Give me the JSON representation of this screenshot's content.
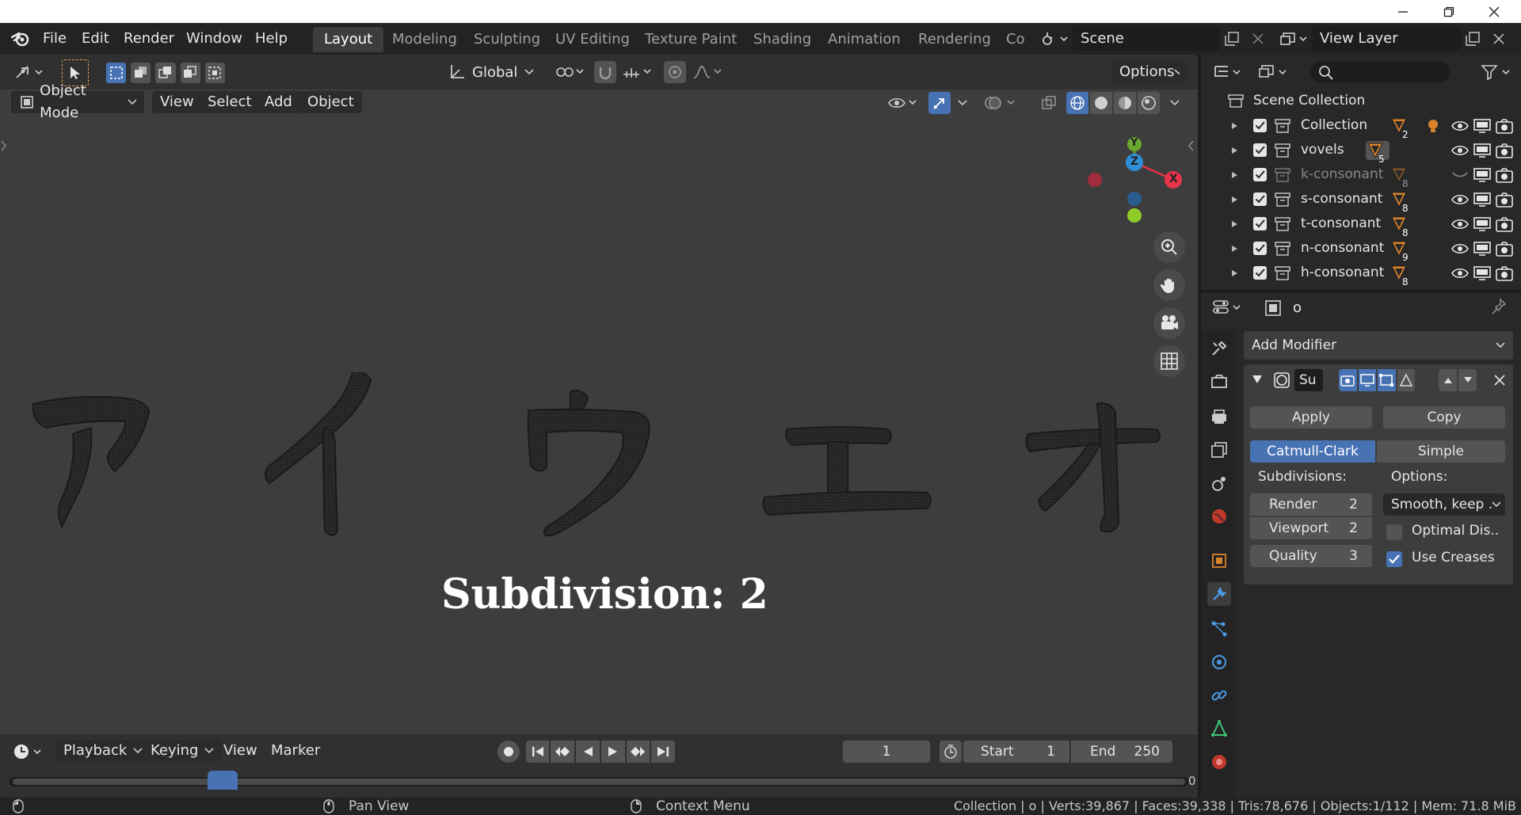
{
  "menu": {
    "items": [
      "File",
      "Edit",
      "Render",
      "Window",
      "Help"
    ]
  },
  "workspaces": [
    "Layout",
    "Modeling",
    "Sculpting",
    "UV Editing",
    "Texture Paint",
    "Shading",
    "Animation",
    "Rendering",
    "Co"
  ],
  "scene": {
    "name": "Scene",
    "view_layer": "View Layer"
  },
  "viewport": {
    "orientation": "Global",
    "options_label": "Options",
    "mode": "Object Mode",
    "menus": [
      "View",
      "Select",
      "Add",
      "Object"
    ],
    "overlay_text": "Subdivision: 2",
    "katakana": [
      "ア",
      "イ",
      "ウ",
      "エ",
      "オ"
    ],
    "gizmo_axes": {
      "x": "X",
      "y": "Y",
      "z": "Z"
    }
  },
  "outliner": {
    "root": "Scene Collection",
    "collections": [
      {
        "name": "Collection",
        "count": "2",
        "dim": false
      },
      {
        "name": "vovels",
        "count": "5",
        "dim": false
      },
      {
        "name": "k-consonant",
        "count": "8",
        "dim": true
      },
      {
        "name": "s-consonant",
        "count": "8",
        "dim": false
      },
      {
        "name": "t-consonant",
        "count": "8",
        "dim": false
      },
      {
        "name": "n-consonant",
        "count": "9",
        "dim": false
      },
      {
        "name": "h-consonant",
        "count": "8",
        "dim": false
      }
    ]
  },
  "properties": {
    "object_name": "o",
    "add_modifier": "Add Modifier",
    "modifier_name": "Su",
    "apply": "Apply",
    "copy": "Copy",
    "catmull": "Catmull-Clark",
    "simple": "Simple",
    "subdivisions_label": "Subdivisions:",
    "options_label": "Options:",
    "render_label": "Render",
    "render_value": "2",
    "viewport_label": "Viewport",
    "viewport_value": "2",
    "quality_label": "Quality",
    "quality_value": "3",
    "uv_smooth": "Smooth, keep ...",
    "optimal_display": "Optimal Dis..",
    "use_creases": "Use Creases"
  },
  "timeline": {
    "playback": "Playback",
    "keying": "Keying",
    "view": "View",
    "marker": "Marker",
    "current_frame": "1",
    "start_label": "Start",
    "start_value": "1",
    "end_label": "End",
    "end_value": "250",
    "scrub_end": "0"
  },
  "status": {
    "pan_view": "Pan View",
    "context_menu": "Context Menu",
    "stats": "Collection | o | Verts:39,867 | Faces:39,338 | Tris:78,676 | Objects:1/112 | Mem: 71.8 MiB"
  },
  "colors": {
    "accent": "#4772b3",
    "axis_x": "#e8334a",
    "axis_y": "#6ba82f",
    "axis_z": "#2e8fd8",
    "orange": "#d9822b"
  }
}
